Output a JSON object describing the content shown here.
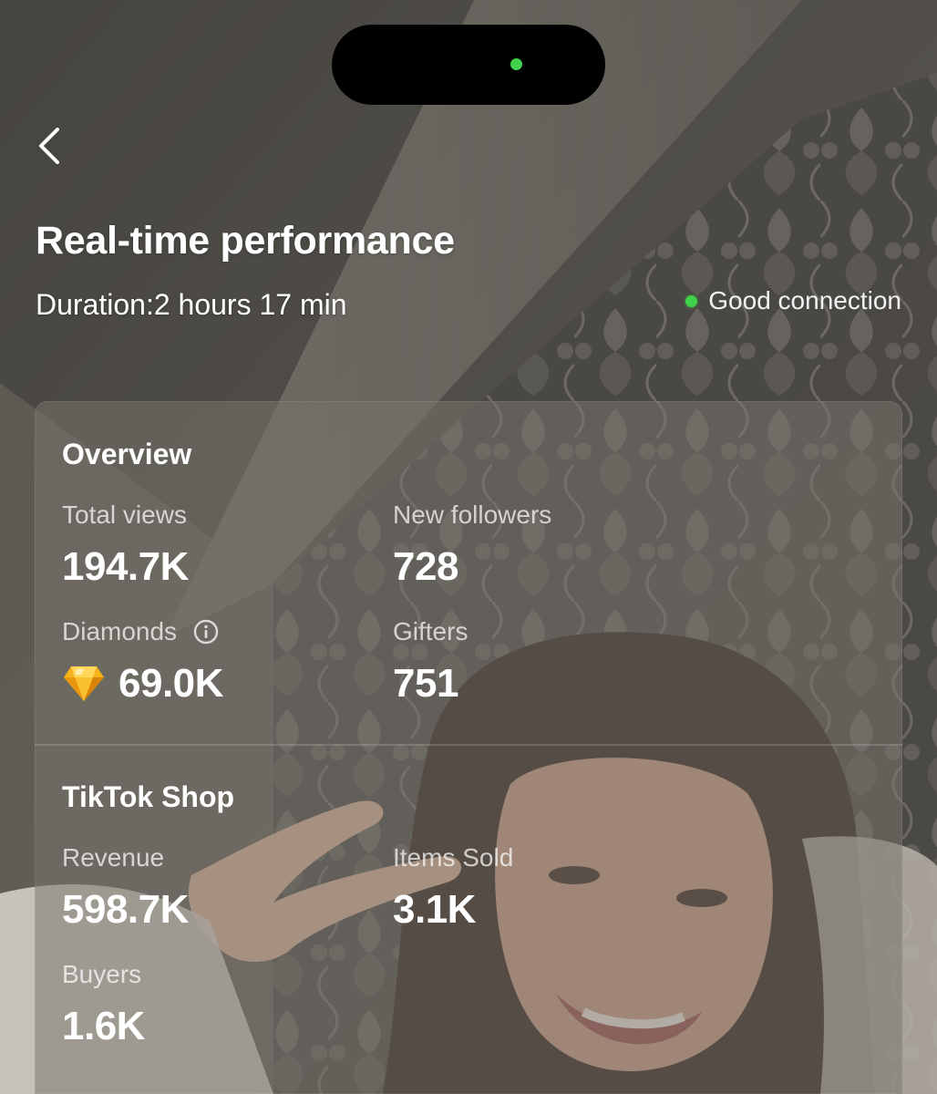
{
  "header": {
    "back_icon": "chevron-left-icon",
    "title": "Real-time performance",
    "duration": "Duration:2 hours 17 min",
    "connection_status": "Good connection",
    "connection_color": "#3fd24a"
  },
  "overview": {
    "title": "Overview",
    "total_views": {
      "label": "Total views",
      "value": "194.7K"
    },
    "new_followers": {
      "label": "New followers",
      "value": "728"
    },
    "diamonds": {
      "label": "Diamonds",
      "value": "69.0K",
      "icon": "diamond-icon",
      "info_icon": "info-icon"
    },
    "gifters": {
      "label": "Gifters",
      "value": "751"
    }
  },
  "shop": {
    "title": "TikTok Shop",
    "revenue": {
      "label": "Revenue",
      "value": "598.7K"
    },
    "items_sold": {
      "label": "Items Sold",
      "value": "3.1K"
    },
    "buyers": {
      "label": "Buyers",
      "value": "1.6K"
    }
  },
  "colors": {
    "island": "#000000",
    "island_dot": "#3fd24a",
    "diamond": "#f6b21b",
    "text_primary": "#ffffff"
  }
}
